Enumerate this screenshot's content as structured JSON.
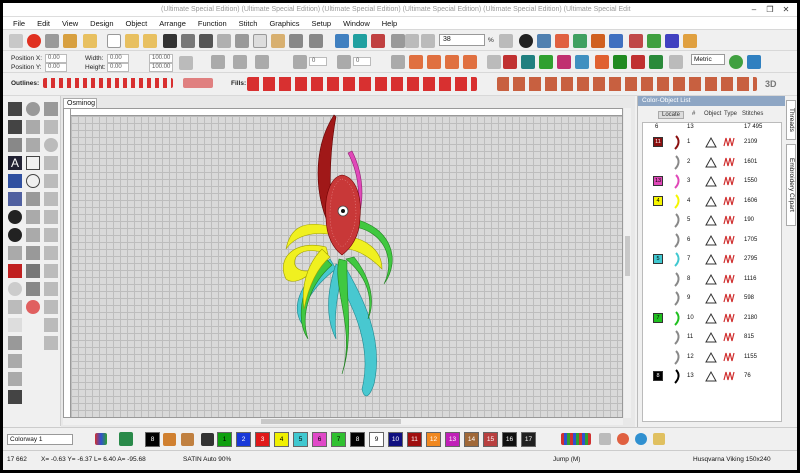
{
  "window": {
    "title": "(Ultimate Special Edition) (Ultimate Special Edition) (Ultimate Special Edition) (Ultimate Special Edition) (Ultimate Special Edition) (Ultimate Special Edit",
    "minimize_glyph": "–",
    "maximize_glyph": "❐",
    "close_glyph": "✕"
  },
  "menu": [
    "File",
    "Edit",
    "View",
    "Design",
    "Object",
    "Arrange",
    "Function",
    "Stitch",
    "Graphics",
    "Setup",
    "Window",
    "Help"
  ],
  "toolbar": {
    "zoom_value": "38",
    "zoom_unit": "%",
    "units": "Metric"
  },
  "position_bar": {
    "position_x_label": "Position X:",
    "position_x_value": "0.00",
    "position_y_label": "Position Y:",
    "position_y_value": "0.00",
    "width_label": "Width:",
    "width_value": "0.00",
    "height_label": "Height:",
    "height_value": "0.00",
    "width_pct": "100.00",
    "height_pct": "100.00",
    "rotate_value": "0",
    "slant_value": "0"
  },
  "outlines_label": "Outlines:",
  "fills_label": "Fills:",
  "document_tab": "Osminog",
  "panel": {
    "title": "Color-Object List",
    "locate_label": "Locate",
    "col_hash": "#",
    "col_object": "Object",
    "col_type": "Type",
    "col_stitches": "Stitches",
    "summary_colors": "6",
    "summary_objects": "13",
    "summary_stitches": "17 495",
    "rows": [
      {
        "color_num": "11",
        "color": "#8b1010",
        "num": "1",
        "stitches": "2109",
        "kind": "satin"
      },
      {
        "color_num": "",
        "color": "",
        "num": "2",
        "stitches": "1601",
        "kind": "fill"
      },
      {
        "color_num": "13",
        "color": "#e048b8",
        "num": "3",
        "stitches": "1550",
        "kind": "satin"
      },
      {
        "color_num": "4",
        "color": "#f5f500",
        "num": "4",
        "stitches": "1606",
        "kind": "satin"
      },
      {
        "color_num": "",
        "color": "",
        "num": "5",
        "stitches": "190",
        "kind": "satin"
      },
      {
        "color_num": "",
        "color": "",
        "num": "6",
        "stitches": "1705",
        "kind": "satin"
      },
      {
        "color_num": "5",
        "color": "#40c8d0",
        "num": "7",
        "stitches": "2795",
        "kind": "satin"
      },
      {
        "color_num": "",
        "color": "",
        "num": "8",
        "stitches": "1116",
        "kind": "satin"
      },
      {
        "color_num": "",
        "color": "",
        "num": "9",
        "stitches": "598",
        "kind": "satin"
      },
      {
        "color_num": "7",
        "color": "#20c020",
        "num": "10",
        "stitches": "2180",
        "kind": "satin"
      },
      {
        "color_num": "",
        "color": "",
        "num": "11",
        "stitches": "815",
        "kind": "satin"
      },
      {
        "color_num": "",
        "color": "",
        "num": "12",
        "stitches": "1155",
        "kind": "satin"
      },
      {
        "color_num": "8",
        "color": "#000000",
        "num": "13",
        "stitches": "76",
        "kind": "satin"
      }
    ]
  },
  "side_tabs": [
    "Threads",
    "Embroidery Clipart"
  ],
  "colorway": "Colorway 1",
  "palette": [
    {
      "num": "8",
      "color": "#000000"
    },
    {
      "num": "1",
      "color": "#10a010"
    },
    {
      "num": "2",
      "color": "#1838d8"
    },
    {
      "num": "3",
      "color": "#e01818"
    },
    {
      "num": "4",
      "color": "#f0f000"
    },
    {
      "num": "5",
      "color": "#40c8d0"
    },
    {
      "num": "6",
      "color": "#e048c8"
    },
    {
      "num": "7",
      "color": "#30c030"
    },
    {
      "num": "8",
      "color": "#000000"
    },
    {
      "num": "9",
      "color": "#ffffff"
    },
    {
      "num": "10",
      "color": "#101080"
    },
    {
      "num": "11",
      "color": "#a01010"
    },
    {
      "num": "12",
      "color": "#f08820"
    },
    {
      "num": "13",
      "color": "#c020b8"
    },
    {
      "num": "14",
      "color": "#a06838"
    },
    {
      "num": "15",
      "color": "#b84040"
    },
    {
      "num": "16",
      "color": "#101010"
    },
    {
      "num": "17",
      "color": "#202020"
    }
  ],
  "status": {
    "stitches": "17 662",
    "coords": "X= -0.63 Y= -6.37 L= 6.40 A= -95.68",
    "stitch_type": "SATIN Auto 90%",
    "mode": "Jump (M)",
    "machine": "Husqvarna Viking 150x240"
  }
}
